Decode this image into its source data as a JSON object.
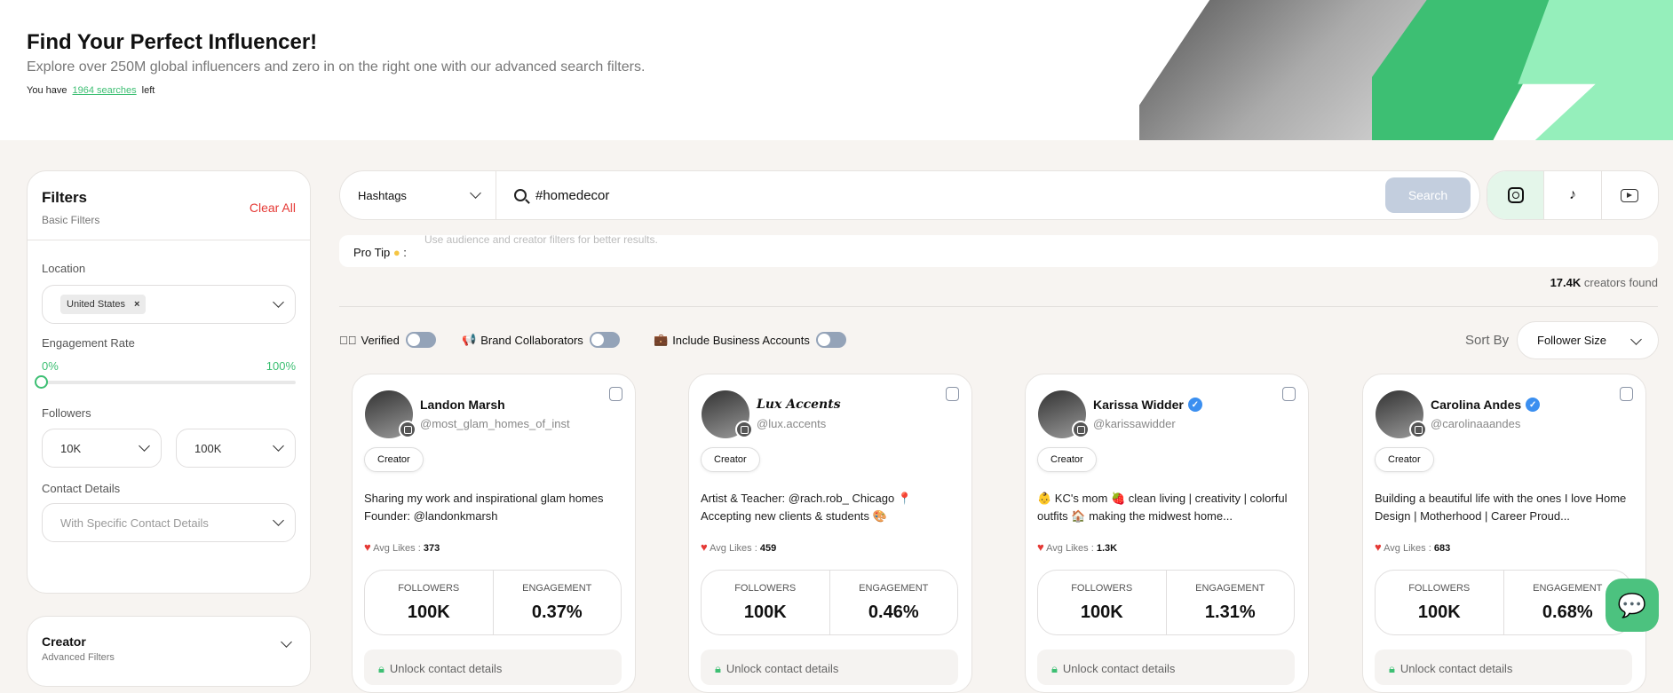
{
  "hero": {
    "title": "Find Your Perfect Influencer!",
    "subtitle": "Explore over 250M global influencers and zero in on the right one with our advanced search filters.",
    "quota_prefix": "You have",
    "quota_link": "1964 searches",
    "quota_suffix": "left"
  },
  "filters": {
    "title": "Filters",
    "subtitle": "Basic Filters",
    "clear": "Clear All",
    "location_label": "Location",
    "location_chip": "United States",
    "engagement_label": "Engagement Rate",
    "eng_min": "0%",
    "eng_max": "100%",
    "eng_value": 0,
    "followers_label": "Followers",
    "followers_min": "10K",
    "followers_max": "100K",
    "contact_label": "Contact Details",
    "contact_placeholder": "With Specific Contact Details"
  },
  "creator_panel": {
    "title": "Creator",
    "subtitle": "Advanced Filters"
  },
  "search": {
    "type": "Hashtags",
    "query": "#homedecor",
    "button": "Search"
  },
  "platforms": [
    {
      "icon": "instagram-icon",
      "active": true
    },
    {
      "icon": "tiktok-icon",
      "active": false
    },
    {
      "icon": "youtube-icon",
      "active": false
    }
  ],
  "protip": {
    "label": "Pro Tip",
    "text": "Use audience and creator filters for better results."
  },
  "results": {
    "count": "17.4K",
    "count_suffix": "creators found"
  },
  "toggles": {
    "verified": "Verified",
    "brand": "Brand Collaborators",
    "business": "Include Business Accounts"
  },
  "sort": {
    "label": "Sort By",
    "value": "Follower Size"
  },
  "card_labels": {
    "type": "Creator",
    "avg_likes": "Avg Likes :",
    "followers": "FOLLOWERS",
    "engagement": "ENGAGEMENT",
    "unlock": "Unlock contact details"
  },
  "cards": [
    {
      "name": "Landon Marsh",
      "handle": "@most_glam_homes_of_inst",
      "verified": false,
      "bio": "Sharing my work and inspirational glam homes Founder: @landonkmarsh",
      "likes": "373",
      "followers": "100K",
      "engagement": "0.37%"
    },
    {
      "name": "Lux Accents",
      "handle": "@lux.accents",
      "verified": false,
      "bio": "Artist & Teacher: @rach.rob_ Chicago 📍 Accepting new clients & students 🎨",
      "likes": "459",
      "followers": "100K",
      "engagement": "0.46%"
    },
    {
      "name": "Karissa Widder",
      "handle": "@karissawidder",
      "verified": true,
      "bio": "👶 KC's mom 🍓 clean living | creativity | colorful outfits 🏠 making the midwest home...",
      "likes": "1.3K",
      "followers": "100K",
      "engagement": "1.31%"
    },
    {
      "name": "Carolina Andes",
      "handle": "@carolinaaandes",
      "verified": true,
      "bio": "Building a beautiful life with the ones I love Home Design | Motherhood | Career Proud...",
      "likes": "683",
      "followers": "100K",
      "engagement": "0.68%"
    }
  ],
  "colors": {
    "accent": "#3dbf73",
    "danger": "#e53935",
    "background": "#f7f4f1"
  }
}
